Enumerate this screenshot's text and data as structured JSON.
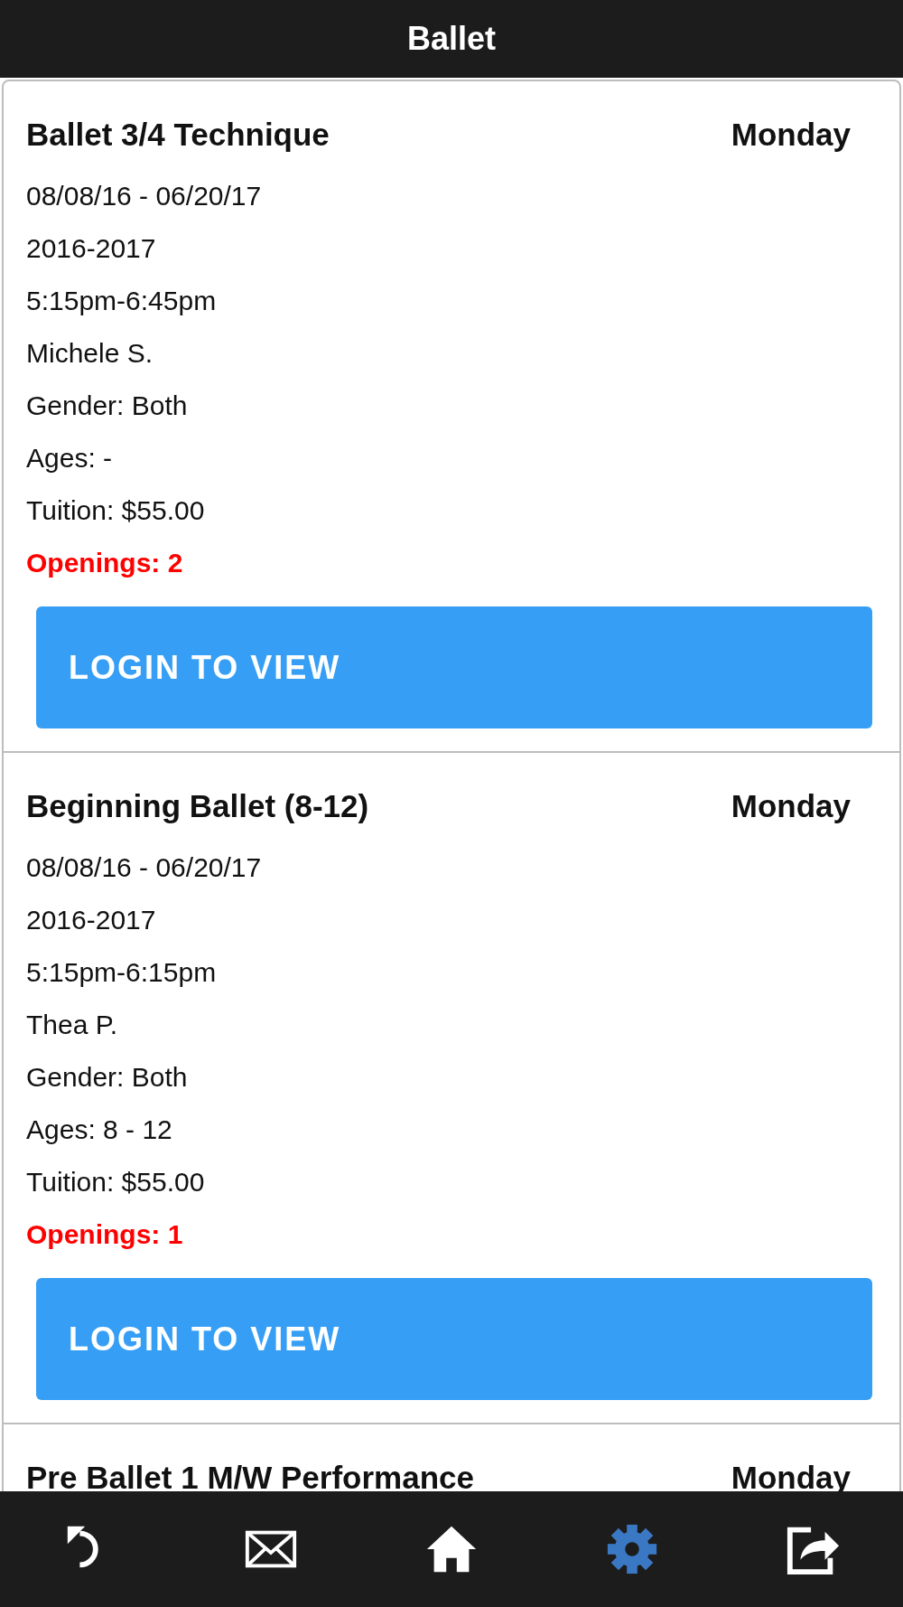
{
  "header": {
    "title": "Ballet"
  },
  "classes": [
    {
      "name": "Ballet 3/4 Technique",
      "day": "Monday",
      "details": [
        {
          "kind": "detail",
          "text": "08/08/16 - 06/20/17"
        },
        {
          "kind": "detail",
          "text": "2016-2017"
        },
        {
          "kind": "detail",
          "text": "5:15pm-6:45pm"
        },
        {
          "kind": "detail",
          "text": "Michele S."
        },
        {
          "kind": "detail",
          "text": "Gender: Both"
        },
        {
          "kind": "detail",
          "text": "Ages: -"
        },
        {
          "kind": "detail",
          "text": "Tuition: $55.00"
        },
        {
          "kind": "openings",
          "text": "Openings: 2"
        }
      ],
      "button": "LOGIN TO VIEW"
    },
    {
      "name": "Beginning Ballet (8-12)",
      "day": "Monday",
      "details": [
        {
          "kind": "detail",
          "text": "08/08/16 - 06/20/17"
        },
        {
          "kind": "detail",
          "text": "2016-2017"
        },
        {
          "kind": "detail",
          "text": "5:15pm-6:15pm"
        },
        {
          "kind": "detail",
          "text": "Thea P."
        },
        {
          "kind": "detail",
          "text": "Gender: Both"
        },
        {
          "kind": "detail",
          "text": "Ages: 8 - 12"
        },
        {
          "kind": "detail",
          "text": "Tuition: $55.00"
        },
        {
          "kind": "openings",
          "text": "Openings: 1"
        }
      ],
      "button": "LOGIN TO VIEW"
    },
    {
      "name": "Pre Ballet 1 M/W Performance",
      "day": "Monday"
    }
  ],
  "nav": {
    "items": [
      {
        "selected": false
      },
      {
        "selected": false
      },
      {
        "selected": false
      },
      {
        "selected": true
      },
      {
        "selected": false
      }
    ]
  }
}
